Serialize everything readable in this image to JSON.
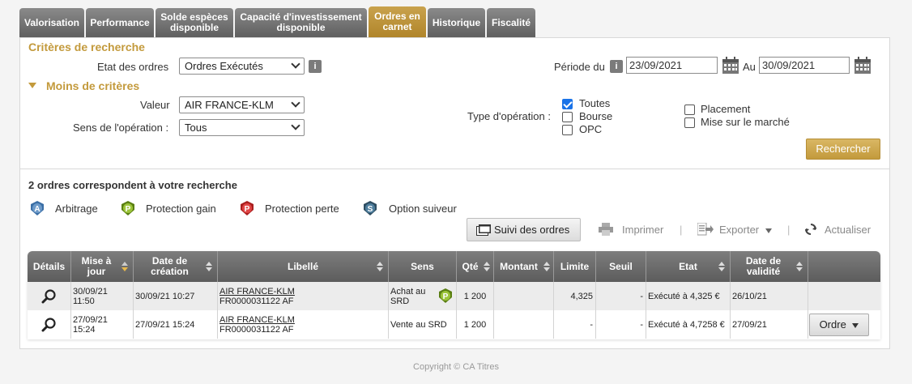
{
  "tabs": [
    {
      "label": "Valorisation"
    },
    {
      "label": "Performance"
    },
    {
      "label": "Solde espèces disponible"
    },
    {
      "label": "Capacité d'investissement disponible"
    },
    {
      "label": "Ordres en carnet"
    },
    {
      "label": "Historique"
    },
    {
      "label": "Fiscalité"
    }
  ],
  "search": {
    "title": "Critères de recherche",
    "etat_label": "Etat des ordres",
    "etat_value": "Ordres Exécutés",
    "periode_label": "Période du",
    "date_from": "23/09/2021",
    "au_label": "Au",
    "date_to": "30/09/2021",
    "moins_criteres": "Moins de critères",
    "valeur_label": "Valeur",
    "valeur_value": "AIR FRANCE-KLM",
    "sens_label": "Sens de l'opération :",
    "sens_value": "Tous",
    "type_label": "Type d'opération :",
    "types": [
      {
        "label": "Toutes",
        "checked": true
      },
      {
        "label": "Bourse",
        "checked": false
      },
      {
        "label": "OPC",
        "checked": false
      },
      {
        "label": "Placement",
        "checked": false
      },
      {
        "label": "Mise sur le marché",
        "checked": false
      }
    ],
    "search_button": "Rechercher",
    "info_glyph": "i"
  },
  "results": {
    "count_text": "2 ordres correspondent à votre recherche",
    "legend": [
      {
        "label": "Arbitrage",
        "letter": "A",
        "color": "#3a6ea5",
        "icon": "arbitrage-icon"
      },
      {
        "label": "Protection gain",
        "letter": "P",
        "color": "#7aa51e",
        "icon": "protection-gain-icon"
      },
      {
        "label": "Protection perte",
        "letter": "P",
        "color": "#d02e2e",
        "icon": "protection-perte-icon"
      },
      {
        "label": "Option suiveur",
        "letter": "S",
        "color": "#2e5f80",
        "icon": "option-suiveur-icon"
      }
    ],
    "suivi_button": "Suivi des ordres",
    "imprimer": "Imprimer",
    "exporter": "Exporter",
    "actualiser": "Actualiser",
    "separator": "|"
  },
  "table": {
    "headers": [
      "Détails",
      "Mise à jour",
      "Date de création",
      "Libellé",
      "Sens",
      "Qté",
      "Montant",
      "Limite",
      "Seuil",
      "Etat",
      "Date de validité",
      ""
    ],
    "rows": [
      {
        "mise_a_jour": "30/09/21 11:50",
        "date_creation": "30/09/21 10:27",
        "libelle": "AIR FRANCE-KLM",
        "isin": "FR0000031122 AF",
        "sens": "Achat au SRD",
        "sens_badge": "P",
        "qte": "1 200",
        "montant": "",
        "limite": "4,325",
        "seuil": "-",
        "etat": "Exécuté à 4,325 €",
        "validite": "26/10/21",
        "action": ""
      },
      {
        "mise_a_jour": "27/09/21 15:24",
        "date_creation": "27/09/21 15:24",
        "libelle": "AIR FRANCE-KLM",
        "isin": "FR0000031122 AF",
        "sens": "Vente au SRD",
        "sens_badge": "",
        "qte": "1 200",
        "montant": "",
        "limite": "-",
        "seuil": "-",
        "etat": "Exécuté à 4,7258 €",
        "validite": "27/09/21",
        "action": "Ordre"
      }
    ]
  },
  "footer": {
    "copyright": "Copyright © CA Titres"
  },
  "colors": {
    "gold": "#c39a3c",
    "tab_grey": "#6e6e6e",
    "check_blue": "#1a73e8"
  }
}
